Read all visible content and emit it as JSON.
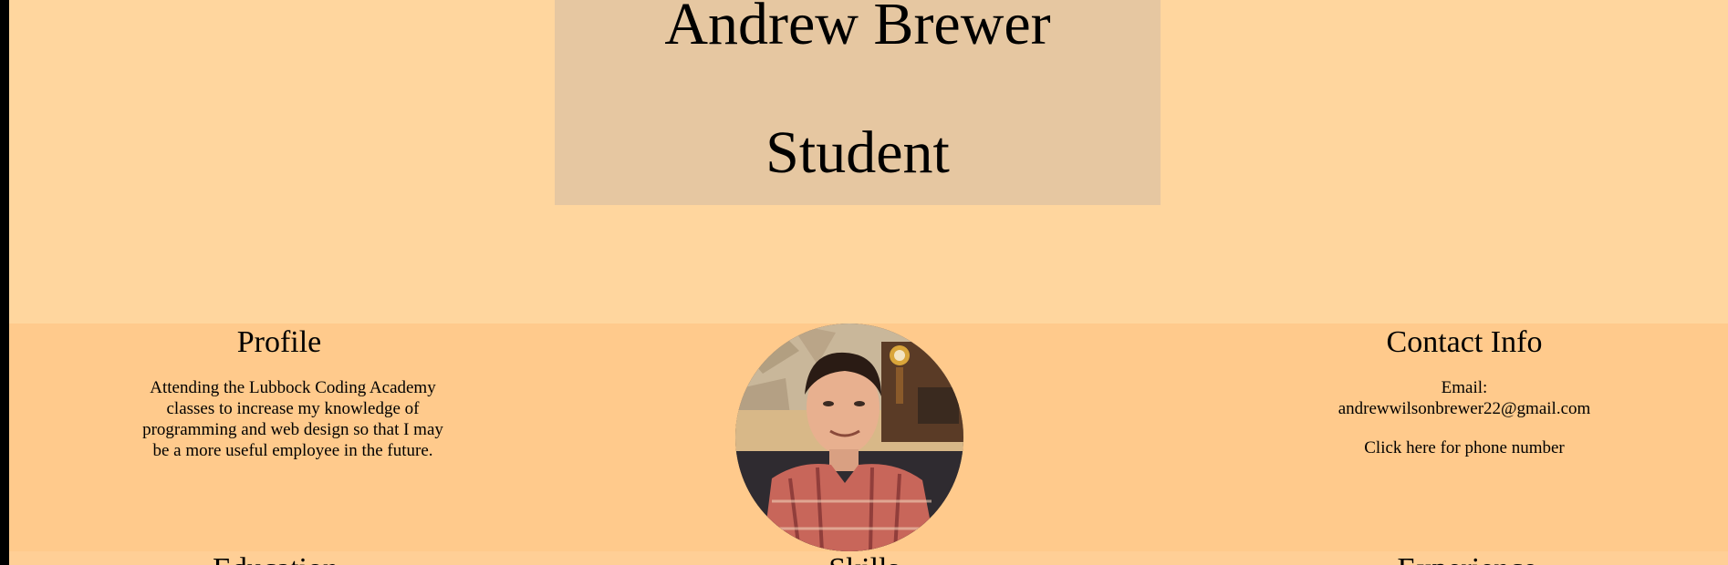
{
  "header": {
    "name": "Andrew Brewer",
    "role": "Student"
  },
  "profile": {
    "heading": "Profile",
    "text": "Attending the Lubbock Coding Academy classes to increase my knowledge of programming and web design so that I may be a more useful employee in the future."
  },
  "photo": {
    "alt": "Andrew Brewer"
  },
  "contact": {
    "heading": "Contact Info",
    "email_label": "Email:",
    "email": "andrewwilsonbrewer22@gmail.com",
    "phone_link": "Click here for phone number"
  },
  "sections": {
    "education": "Education",
    "skills": "Skills",
    "experience": "Experience"
  },
  "colors": {
    "background": "#ffd69e",
    "title_card": "#e6c7a1",
    "info_band": "#ffca8c"
  }
}
